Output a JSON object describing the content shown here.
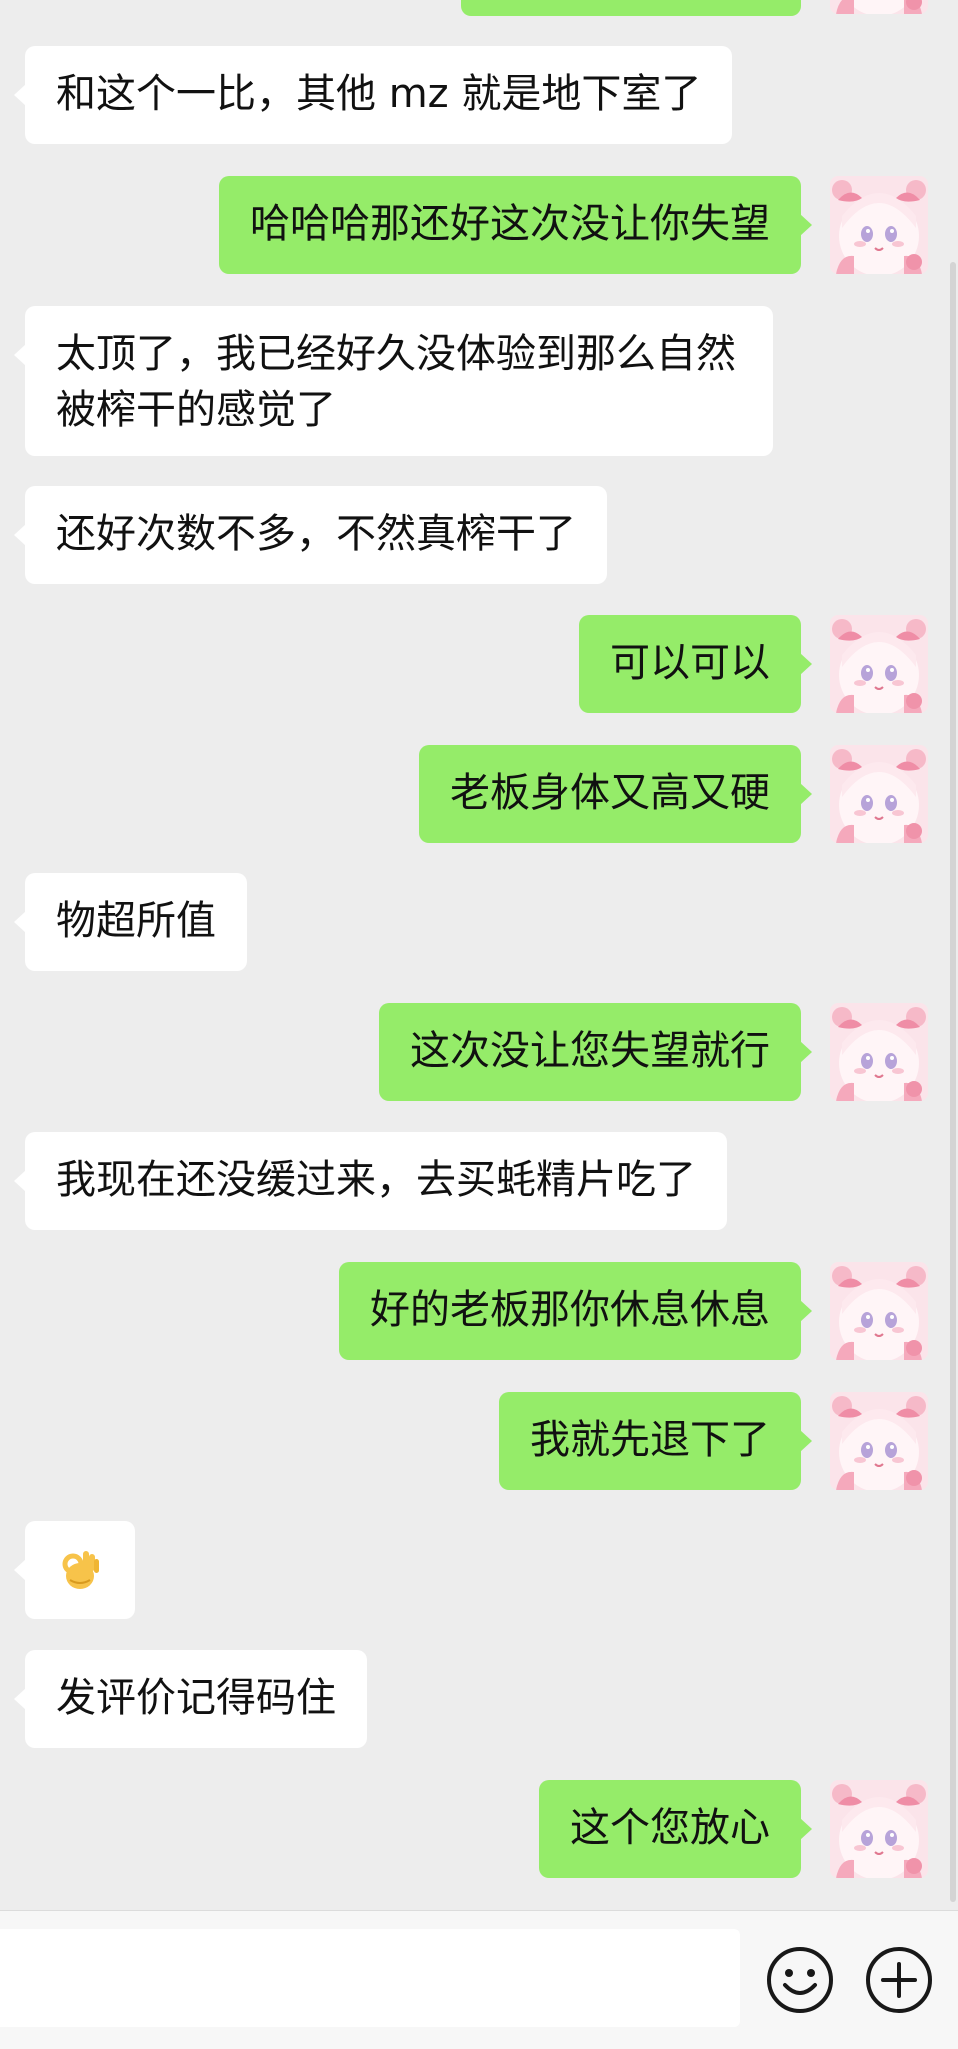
{
  "chat": {
    "messages": [
      {
        "side": "left",
        "text": "和这个一比，其他 mz 就是地下室了"
      },
      {
        "side": "right",
        "text": "哈哈哈那还好这次没让你失望"
      },
      {
        "side": "left",
        "text": "太顶了，我已经好久没体验到那么自然被榨干的感觉了"
      },
      {
        "side": "left",
        "text": "还好次数不多，不然真榨干了"
      },
      {
        "side": "right",
        "text": "可以可以"
      },
      {
        "side": "right",
        "text": "老板身体又高又硬"
      },
      {
        "side": "left",
        "text": "物超所值"
      },
      {
        "side": "right",
        "text": "这次没让您失望就行"
      },
      {
        "side": "left",
        "text": "我现在还没缓过来，去买蚝精片吃了"
      },
      {
        "side": "right",
        "text": "好的老板那你休息休息"
      },
      {
        "side": "right",
        "text": "我就先退下了"
      },
      {
        "side": "left",
        "type": "emoji",
        "emoji": "ok-hand-emoji"
      },
      {
        "side": "left",
        "text": "发评价记得码住"
      },
      {
        "side": "right",
        "text": "这个您放心"
      }
    ]
  },
  "input_bar": {
    "input_value": "",
    "icons": [
      "emoji-icon",
      "plus-icon"
    ]
  },
  "colors": {
    "background": "#ededed",
    "self_bubble": "#95ec69",
    "other_bubble": "#ffffff"
  }
}
